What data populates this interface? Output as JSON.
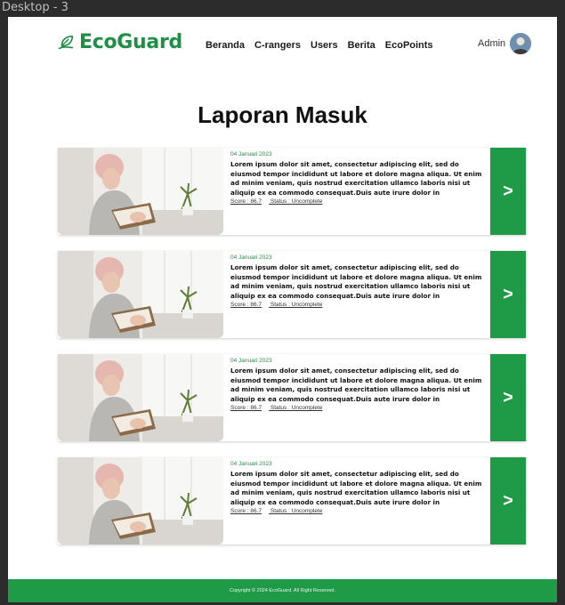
{
  "frame": {
    "label": "Desktop - 3"
  },
  "header": {
    "brand": "EcoGuard",
    "menu": [
      {
        "label": "Beranda"
      },
      {
        "label": "C-rangers"
      },
      {
        "label": "Users"
      },
      {
        "label": "Berita"
      },
      {
        "label": "EcoPoints"
      }
    ],
    "user_label": "Admin",
    "brand_color": "#1f8f45"
  },
  "main": {
    "title": "Laporan Masuk",
    "reports": [
      {
        "date": "04 Januari 2023",
        "description": "Lorem ipsum dolor sit amet, consectetur adipiscing elit, sed do eiusmod tempor incididunt ut labore et dolore magna aliqua. Ut enim ad minim veniam, quis nostrud exercitation ullamco laboris nisi ut aliquip ex ea commodo consequat.Duis aute irure dolor in",
        "score": "Score : 86.7",
        "status": "Status : Uncomplete",
        "action": ">"
      },
      {
        "date": "04 Januari 2023",
        "description": "Lorem ipsum dolor sit amet, consectetur adipiscing elit, sed do eiusmod tempor incididunt ut labore et dolore magna aliqua. Ut enim ad minim veniam, quis nostrud exercitation ullamco laboris nisi ut aliquip ex ea commodo consequat.Duis aute irure dolor in",
        "score": "Score : 86.7",
        "status": "Status : Uncomplete",
        "action": ">"
      },
      {
        "date": "04 Januari 2023",
        "description": "Lorem ipsum dolor sit amet, consectetur adipiscing elit, sed do eiusmod tempor incididunt ut labore et dolore magna aliqua. Ut enim ad minim veniam, quis nostrud exercitation ullamco laboris nisi ut aliquip ex ea commodo consequat.Duis aute irure dolor in",
        "score": "Score : 86.7",
        "status": "Status : Uncomplete",
        "action": ">"
      },
      {
        "date": "04 Januari 2023",
        "description": "Lorem ipsum dolor sit amet, consectetur adipiscing elit, sed do eiusmod tempor incididunt ut labore et dolore magna aliqua. Ut enim ad minim veniam, quis nostrud exercitation ullamco laboris nisi ut aliquip ex ea commodo consequat.Duis aute irure dolor in",
        "score": "Score : 86.7",
        "status": "Status : Uncomplete",
        "action": ">"
      }
    ]
  },
  "footer": {
    "copyright": "Copyright © 2024 EcoGuard. All Right Reserved."
  },
  "colors": {
    "accent": "#1f9a47",
    "background": "#ffffff",
    "frame_bg": "#2c2c2c"
  }
}
